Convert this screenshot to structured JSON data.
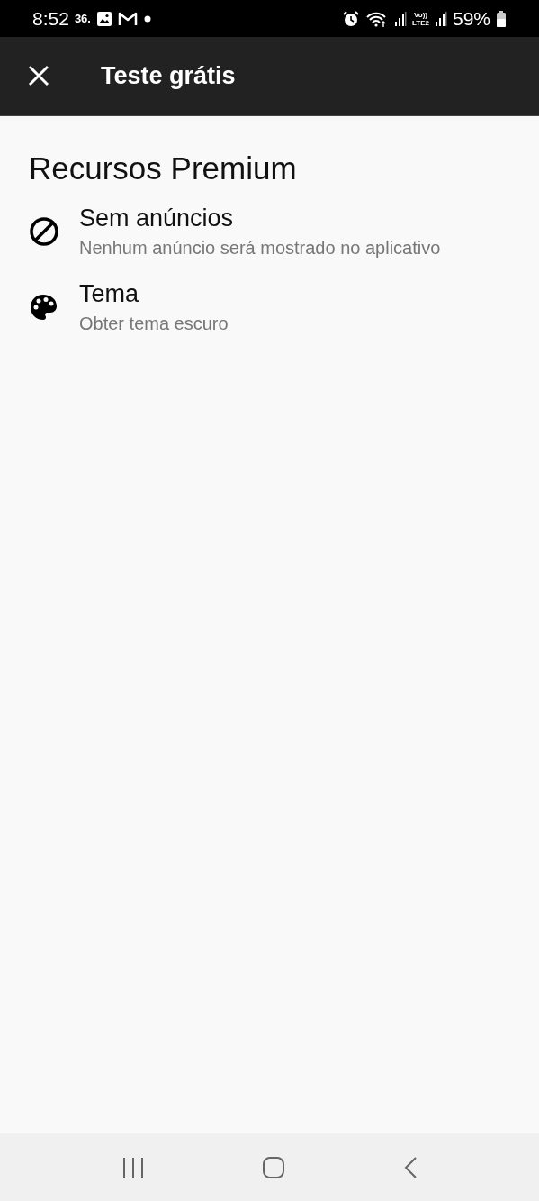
{
  "status_bar": {
    "time": "8:52",
    "notification_text": "36.",
    "volte_label": "Vo))",
    "lte_label": "LTE2",
    "battery": "59%"
  },
  "app_bar": {
    "title": "Teste grátis"
  },
  "section": {
    "title": "Recursos Premium"
  },
  "features": [
    {
      "kind": "no-ads",
      "title": "Sem anúncios",
      "subtitle": "Nenhum anúncio será mostrado no aplicativo"
    },
    {
      "kind": "theme",
      "title": "Tema",
      "subtitle": "Obter tema escuro"
    }
  ]
}
